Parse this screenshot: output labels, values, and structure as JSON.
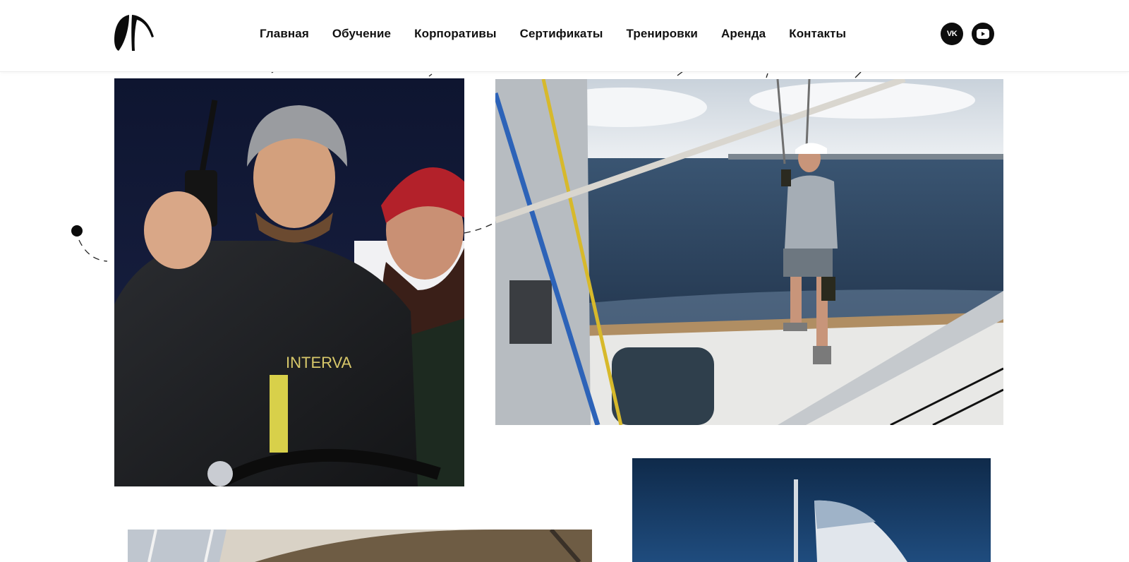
{
  "brand": {
    "logo_icon": "sail-logo-icon"
  },
  "nav": {
    "items": [
      {
        "label": "Главная"
      },
      {
        "label": "Обучение"
      },
      {
        "label": "Корпоративы"
      },
      {
        "label": "Сертификаты"
      },
      {
        "label": "Тренировки"
      },
      {
        "label": "Аренда"
      },
      {
        "label": "Контакты"
      }
    ]
  },
  "socials": {
    "vk": {
      "icon": "vk-icon",
      "text": "VK"
    },
    "youtube": {
      "icon": "youtube-icon"
    }
  },
  "gallery": {
    "photos": [
      {
        "name": "crew-at-helm-photo"
      },
      {
        "name": "sailor-on-deck-photo"
      },
      {
        "name": "sail-photo"
      },
      {
        "name": "canopy-photo"
      }
    ]
  },
  "colors": {
    "text": "#111111",
    "background": "#ffffff",
    "icon_bg": "#0d0d0d"
  }
}
